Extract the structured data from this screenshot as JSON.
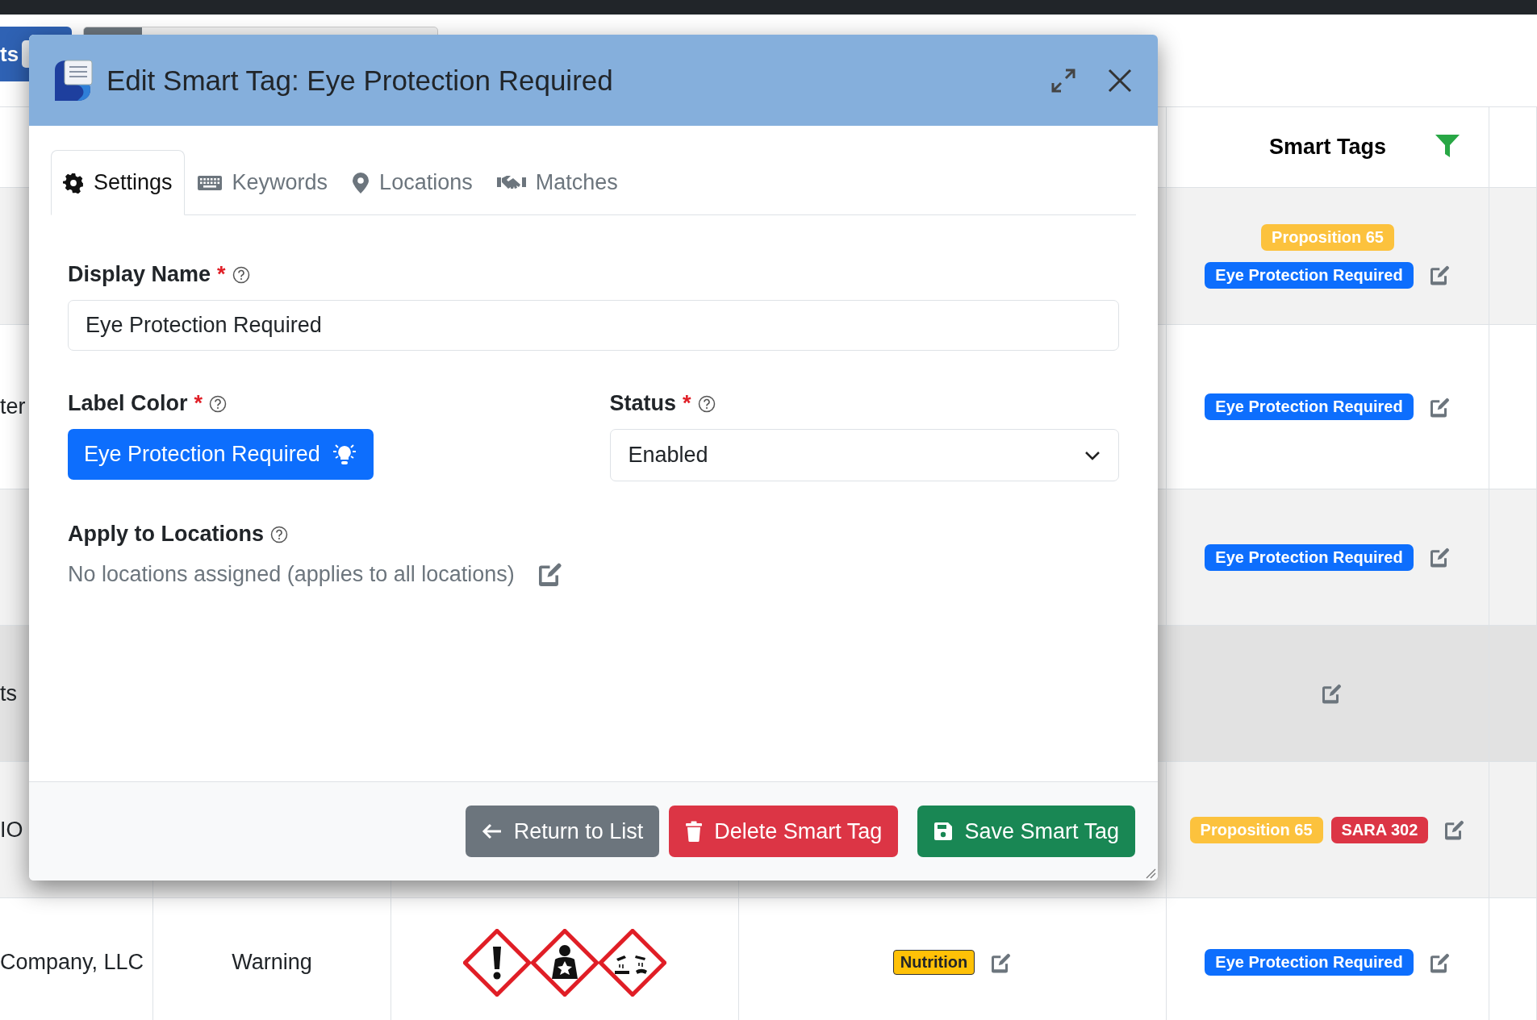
{
  "toolbar": {
    "button": "ts"
  },
  "table": {
    "header": {
      "label": "Smart Tags"
    },
    "rows": [
      {
        "hovered": false,
        "tag_lines": [
          [
            {
              "label": "Proposition 65",
              "color": "#fcc23d"
            }
          ],
          [
            {
              "label": "Eye Protection Required",
              "color": "#0d6efd"
            }
          ]
        ]
      },
      {
        "hovered": false,
        "column_1": "ter",
        "tag_lines": [
          [
            {
              "label": "Eye Protection Required",
              "color": "#0d6efd"
            }
          ]
        ]
      },
      {
        "hovered": false,
        "tag_lines": [
          [
            {
              "label": "Eye Protection Required",
              "color": "#0d6efd"
            }
          ]
        ]
      },
      {
        "hovered": true,
        "column_1": "ts"
      },
      {
        "hovered": false,
        "column_1": "IO",
        "tag_lines": [
          [
            {
              "label": "Proposition 65",
              "color": "#fcc23d"
            },
            {
              "label": "SARA 302",
              "color": "#dc3545"
            }
          ]
        ]
      },
      {
        "hovered": false,
        "column_1": "Company, LLC",
        "column_2": "Warning",
        "pictograms": [
          {
            "kind": "exclamation"
          },
          {
            "kind": "health"
          },
          {
            "kind": "corrosion"
          }
        ],
        "nutrition_tag": {
          "label": "Nutrition",
          "color": "#ffc107"
        },
        "tag_lines": [
          [
            {
              "label": "Eye Protection Required",
              "color": "#0d6efd"
            }
          ]
        ]
      }
    ]
  },
  "dialog": {
    "title": "Edit Smart Tag: Eye Protection Required",
    "tabs": [
      {
        "label": "Settings",
        "selected": true,
        "kind": "gear"
      },
      {
        "label": "Keywords",
        "selected": false,
        "kind": "keyboard"
      },
      {
        "label": "Locations",
        "selected": false,
        "kind": "pin"
      },
      {
        "label": "Matches",
        "selected": false,
        "kind": "handshake"
      }
    ],
    "display_name": {
      "label": "Display Name",
      "required_mark": "*",
      "value": "Eye Protection Required"
    },
    "label_color": {
      "label": "Label Color",
      "required_mark": "*",
      "tag": {
        "label": "Eye Protection Required",
        "color": "#0d6efd"
      }
    },
    "status": {
      "label": "Status",
      "required_mark": "*",
      "value": "Enabled"
    },
    "apply_to_locations": {
      "label": "Apply to Locations",
      "note": "No locations assigned (applies to all locations)"
    },
    "buttons": [
      {
        "label": "Return to List",
        "kind": "return"
      },
      {
        "label": "Delete Smart Tag",
        "kind": "delete"
      },
      {
        "label": "Save Smart Tag",
        "kind": "save"
      }
    ]
  }
}
